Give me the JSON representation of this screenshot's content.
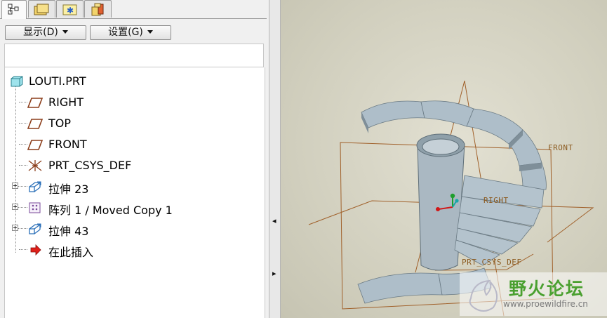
{
  "panel": {
    "tabs": [
      {
        "name": "model-tree-tab",
        "icon": "model-tree-icon",
        "active": true
      },
      {
        "name": "folder-browser-tab",
        "icon": "folder-icon",
        "active": false
      },
      {
        "name": "favorites-tab",
        "icon": "favorites-icon",
        "active": false
      },
      {
        "name": "connections-tab",
        "icon": "connections-icon",
        "active": false
      }
    ],
    "toolbar": {
      "display_label": "显示(D)",
      "settings_label": "设置(G)"
    }
  },
  "tree": {
    "root": {
      "label": "LOUTI.PRT",
      "icon": "part-icon"
    },
    "items": [
      {
        "label": "RIGHT",
        "icon": "datum-plane-icon",
        "expandable": false
      },
      {
        "label": "TOP",
        "icon": "datum-plane-icon",
        "expandable": false
      },
      {
        "label": "FRONT",
        "icon": "datum-plane-icon",
        "expandable": false
      },
      {
        "label": "PRT_CSYS_DEF",
        "icon": "coordinate-system-icon",
        "expandable": false
      },
      {
        "label": "拉伸 23",
        "icon": "extrude-icon",
        "expandable": true
      },
      {
        "label": "阵列 1 / Moved Copy 1",
        "icon": "pattern-icon",
        "expandable": true
      },
      {
        "label": "拉伸 43",
        "icon": "extrude-icon",
        "expandable": true
      },
      {
        "label": "在此插入",
        "icon": "insert-here-arrow-icon",
        "expandable": false
      }
    ]
  },
  "viewport": {
    "plane_labels": {
      "front": "FRONT",
      "right": "RIGHT",
      "csys": "PRT_CSYS_DEF"
    },
    "colors": {
      "model": "#a9b9c4",
      "datum": "#a0602a",
      "background": "#d6d4c3"
    }
  },
  "watermark": {
    "title": "野火论坛",
    "url": "www.proewildfire.cn"
  }
}
